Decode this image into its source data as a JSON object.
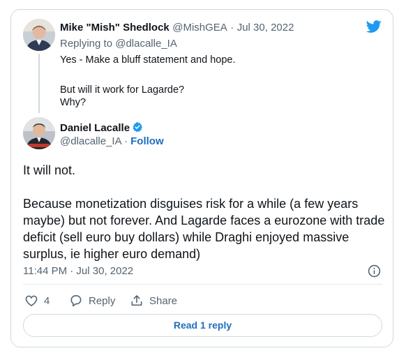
{
  "reply_tweet": {
    "author_name": "Mike \"Mish\" Shedlock",
    "author_handle": "@MishGEA",
    "separator": "·",
    "date": "Jul 30, 2022",
    "replying_to_label": "Replying to",
    "replying_to_handle": "@dlacalle_IA",
    "lines": [
      "Yes - Make a bluff statement and hope.",
      "But will it work for Lagarde?",
      "Why?"
    ]
  },
  "main_tweet": {
    "author_name": "Daniel Lacalle",
    "author_handle": "@dlacalle_IA",
    "separator": "·",
    "follow_label": "Follow",
    "text_line1": "It will not.",
    "text_line2": "Because monetization disguises risk for a while (a few years maybe) but not forever. And Lagarde faces a eurozone with trade deficit (sell euro buy dollars) while Draghi enjoyed massive surplus, ie higher euro demand)",
    "timestamp": "11:44 PM · Jul 30, 2022"
  },
  "actions": {
    "like_count": "4",
    "reply_label": "Reply",
    "share_label": "Share"
  },
  "read_replies_label": "Read 1 reply",
  "icons": {
    "brand": "twitter-bird-icon",
    "verified": "verified-badge-icon",
    "info": "info-icon",
    "like": "heart-icon",
    "reply": "speech-bubble-icon",
    "share": "share-upload-icon"
  },
  "colors": {
    "twitter_blue": "#1d9bf0",
    "link_blue": "#1d6fbf",
    "muted": "#536471",
    "border": "#cfd9de"
  }
}
